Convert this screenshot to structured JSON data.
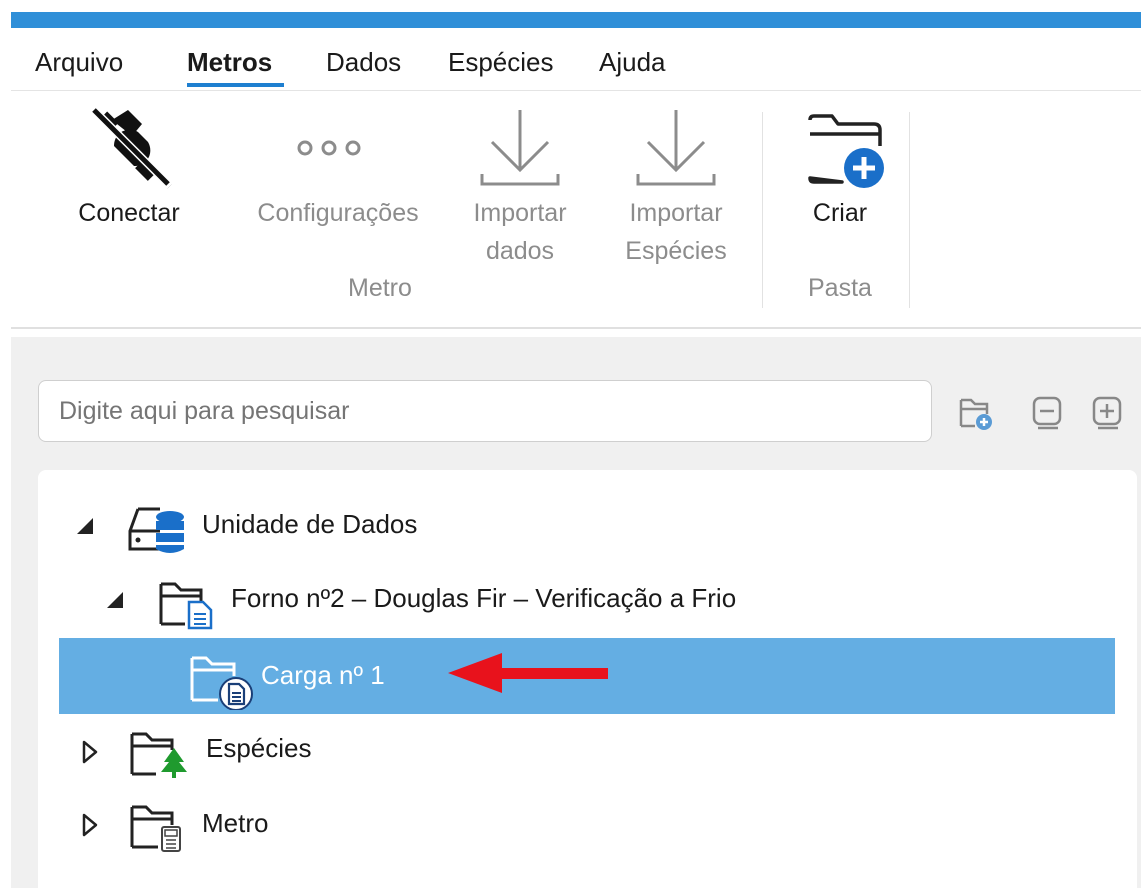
{
  "menu": {
    "items": [
      "Arquivo",
      "Metros",
      "Dados",
      "Espécies",
      "Ajuda"
    ],
    "active": "Metros"
  },
  "ribbon": {
    "connect": "Conectar",
    "settings": "Configurações",
    "import_data_1": "Importar",
    "import_data_2": "dados",
    "import_species_1": "Importar",
    "import_species_2": "Espécies",
    "group_meter": "Metro",
    "create": "Criar",
    "group_folder": "Pasta"
  },
  "search": {
    "placeholder": "Digite aqui para pesquisar"
  },
  "tree": {
    "root": "Unidade de Dados",
    "kiln": "Forno nº2 – Douglas Fir – Verificação a Frio",
    "load": "Carga nº 1",
    "species": "Espécies",
    "meter": "Metro"
  },
  "colors": {
    "accent": "#2f8fd8",
    "selection": "#64aee3",
    "arrow": "#e8121c",
    "tree_green": "#1f9a2e"
  },
  "icons": {
    "connect": "plug-disconnected-icon",
    "settings": "ellipsis-icon",
    "import": "download-arrow-icon",
    "create": "folder-add-icon",
    "database": "database-drive-icon",
    "folder_doc": "folder-document-icon",
    "folder_tree": "folder-tree-icon",
    "folder_meter": "folder-meter-icon"
  }
}
